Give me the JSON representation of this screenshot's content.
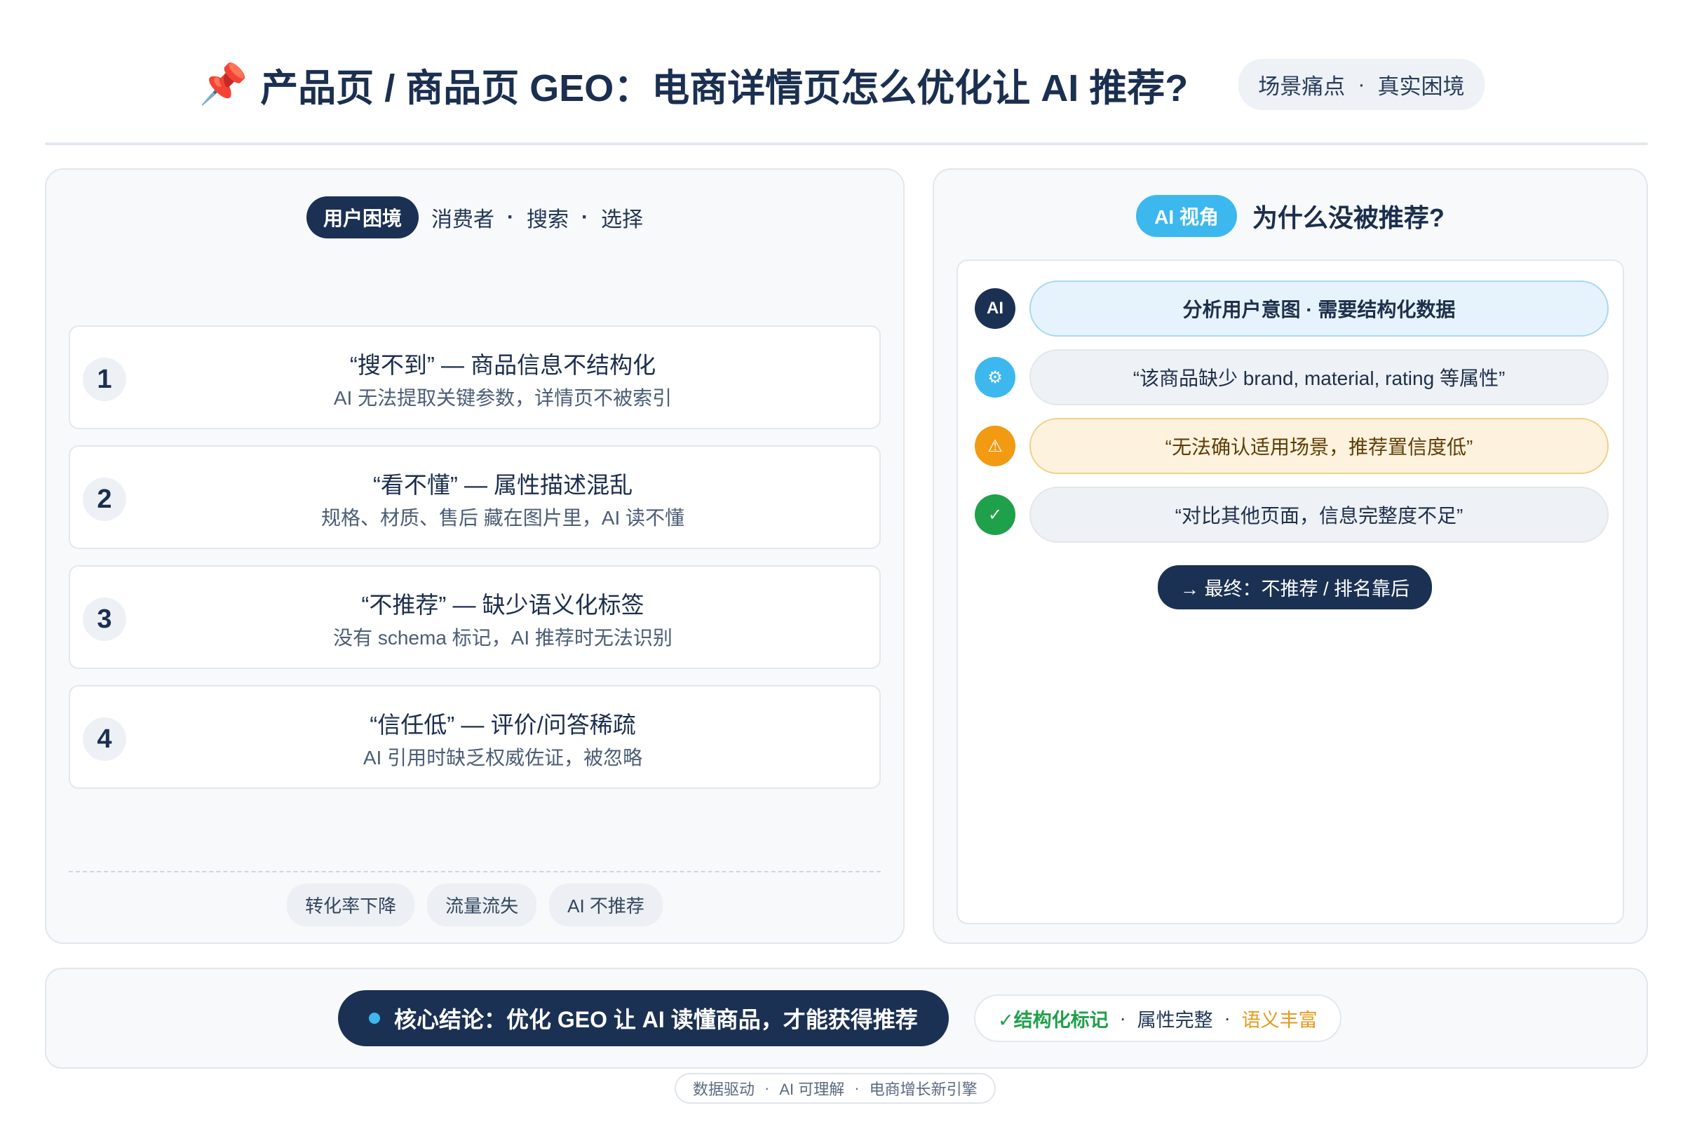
{
  "header": {
    "title": "产品页 / 商品页 GEO：电商详情页怎么优化让 AI 推荐?",
    "icon": "pushpin-icon",
    "tag": [
      "场景痛点",
      "·",
      "真实困境"
    ]
  },
  "left": {
    "badge": "用户困境",
    "subtitle": [
      "消费者",
      "·",
      "搜索",
      "·",
      "选择"
    ],
    "issues": [
      {
        "num": "1",
        "title": "“搜不到” — 商品信息不结构化",
        "sub": "AI 无法提取关键参数，详情页不被索引"
      },
      {
        "num": "2",
        "title": "“看不懂” — 属性描述混乱",
        "sub": "规格、材质、售后 藏在图片里，AI 读不懂"
      },
      {
        "num": "3",
        "title": "“不推荐” — 缺少语义化标签",
        "sub": "没有 schema 标记，AI 推荐时无法识别"
      },
      {
        "num": "4",
        "title": "“信任低” — 评价/问答稀疏",
        "sub": "AI 引用时缺乏权威佐证，被忽略"
      }
    ],
    "chips": [
      "转化率下降",
      "流量流失",
      "AI 不推荐"
    ]
  },
  "right": {
    "badge": "AI 视角",
    "title": "为什么没被推荐?",
    "steps": [
      {
        "icon": "ai-icon",
        "icon_text": "AI",
        "icon_color": "#1b3153",
        "text": "分析用户意图 · 需要结构化数据",
        "style": "blue"
      },
      {
        "icon": "gear-icon",
        "icon_text": "⚙",
        "icon_color": "#3db8ef",
        "text": "“该商品缺少 brand, material, rating 等属性”",
        "style": "gray"
      },
      {
        "icon": "warning-icon",
        "icon_text": "⚠",
        "icon_color": "#f29a12",
        "text": "“无法确认适用场景，推荐置信度低”",
        "style": "yellow"
      },
      {
        "icon": "check-icon",
        "icon_text": "✓",
        "icon_color": "#1fa04a",
        "text": "“对比其他页面，信息完整度不足”",
        "style": "gray"
      }
    ],
    "final": "→ 最终：不推荐 / 排名靠后"
  },
  "bottom": {
    "conclusion": "核心结论：优化 GEO 让 AI 读懂商品，才能获得推荐",
    "features": {
      "green": "✓结构化标记",
      "sep1": "·",
      "mid": "属性完整",
      "sep2": "·",
      "orange": "语义丰富"
    }
  },
  "footer": [
    "数据驱动",
    "·",
    "AI 可理解",
    "·",
    "电商增长新引擎"
  ],
  "colors": {
    "navy": "#1b3153",
    "accent_blue": "#3db8ef",
    "green": "#1fa04a",
    "orange": "#e59a1a"
  }
}
